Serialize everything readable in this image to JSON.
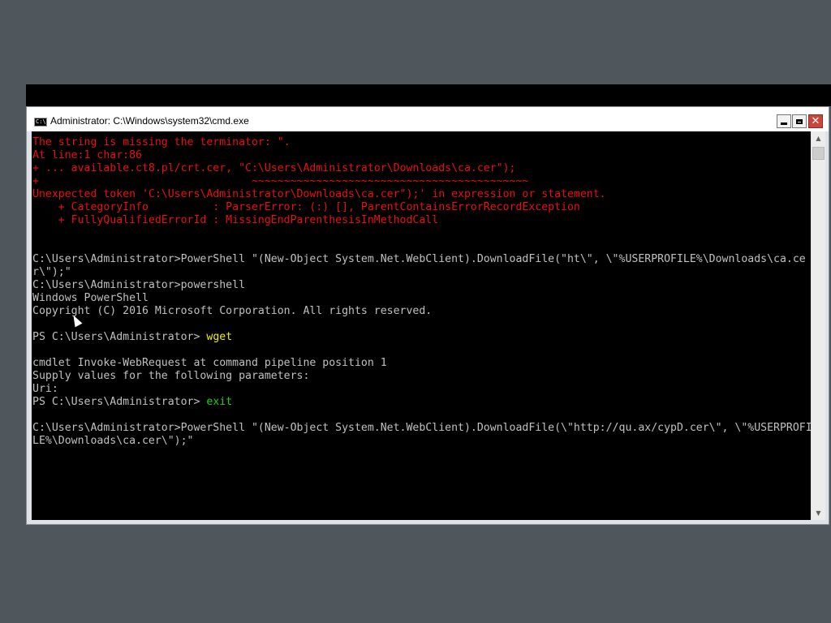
{
  "window": {
    "title": "Administrator: C:\\Windows\\system32\\cmd.exe",
    "icon_text": "C:\\."
  },
  "console": {
    "lines": [
      {
        "text": "+                                                                          ~~~~",
        "style": "err"
      },
      {
        "text": "The string is missing the terminator: \".",
        "style": "err"
      },
      {
        "text": "At line:1 char:86",
        "style": "err"
      },
      {
        "text": "+ ... available.ct8.pl/crt.cer, \"C:\\Users\\Administrator\\Downloads\\ca.cer\");",
        "style": "err"
      },
      {
        "text": "+                                 ~~~~~~~~~~~~~~~~~~~~~~~~~~~~~~~~~~~~~~~~~~~",
        "style": "err"
      },
      {
        "text": "Unexpected token 'C:\\Users\\Administrator\\Downloads\\ca.cer\");' in expression or statement.",
        "style": "err"
      },
      {
        "text": "    + CategoryInfo          : ParserError: (:) [], ParentContainsErrorRecordException",
        "style": "err"
      },
      {
        "text": "    + FullyQualifiedErrorId : MissingEndParenthesisInMethodCall",
        "style": "err"
      },
      {
        "text": "",
        "style": "normal"
      },
      {
        "text": "",
        "style": "normal"
      },
      {
        "text": "C:\\Users\\Administrator>PowerShell \"(New-Object System.Net.WebClient).DownloadFile(\"ht\\\", \\\"%USERPROFILE%\\Downloads\\ca.ce",
        "style": "normal"
      },
      {
        "text": "r\\\");\"",
        "style": "normal"
      },
      {
        "text": "C:\\Users\\Administrator>powershell",
        "style": "normal"
      },
      {
        "text": "Windows PowerShell",
        "style": "normal"
      },
      {
        "text": "Copyright (C) 2016 Microsoft Corporation. All rights reserved.",
        "style": "normal"
      },
      {
        "text": "",
        "style": "normal"
      },
      {
        "text": "PS C:\\Users\\Administrator> ",
        "style": "normal",
        "cmd": "wget",
        "cmd_color": "yellow"
      },
      {
        "text": "",
        "style": "normal"
      },
      {
        "text": "cmdlet Invoke-WebRequest at command pipeline position 1",
        "style": "normal"
      },
      {
        "text": "Supply values for the following parameters:",
        "style": "normal"
      },
      {
        "text": "Uri:",
        "style": "normal"
      },
      {
        "text": "PS C:\\Users\\Administrator> ",
        "style": "normal",
        "cmd": "exit",
        "cmd_color": "green"
      },
      {
        "text": "",
        "style": "normal"
      },
      {
        "text": "C:\\Users\\Administrator>PowerShell \"(New-Object System.Net.WebClient).DownloadFile(\\\"http://qu.ax/cypD.cer\\\", \\\"%USERPROFI",
        "style": "normal"
      },
      {
        "text": "LE%\\Downloads\\ca.cer\\\");\"",
        "style": "normal"
      }
    ]
  },
  "colors": {
    "error_text": "#e81010",
    "normal_text": "#c0c0c0",
    "wget_cmd": "#f0f000",
    "exit_cmd": "#20d020",
    "close_button": "#c8463b"
  }
}
